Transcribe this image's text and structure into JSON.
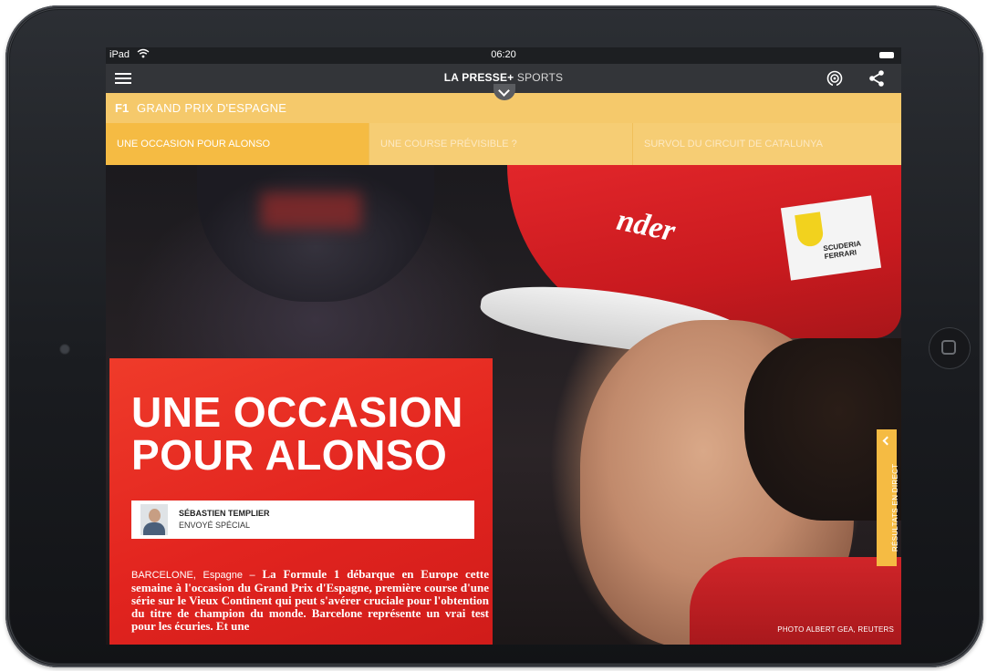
{
  "statusbar": {
    "device": "iPad",
    "time": "06:20"
  },
  "navbar": {
    "brand": "LA PRESSE+",
    "section": "SPORTS"
  },
  "section_bar": {
    "prefix": "F1",
    "label": "GRAND PRIX D'ESPAGNE"
  },
  "tabs": [
    {
      "label": "UNE OCCASION POUR ALONSO",
      "active": true
    },
    {
      "label": "UNE COURSE PRÉVISIBLE ?",
      "active": false
    },
    {
      "label": "SURVOL DU CIRCUIT DE CATALUNYA",
      "active": false
    }
  ],
  "article": {
    "headline": "UNE OCCASION POUR ALONSO",
    "author": {
      "name": "SÉBASTIEN TEMPLIER",
      "role": "ENVOYÉ SPÉCIAL"
    },
    "dateline": "BARCELONE, Espagne –",
    "lede": "La Formule 1 débarque en Europe cette semaine à l'occasion du Grand Prix d'Espagne, première course d'une série sur le Vieux Continent qui peut s'avérer cruciale pour l'obtention du titre de champion du monde. Barcelone représente un vrai test pour les écuries. Et une"
  },
  "live_tab": {
    "label": "RÉSULTATS EN DIRECT"
  },
  "photo_credit": "PHOTO ALBERT GEA, REUTERS",
  "colors": {
    "accent_yellow": "#f5bb43",
    "headline_red": "#e2241f",
    "nav_dark": "#333539"
  }
}
